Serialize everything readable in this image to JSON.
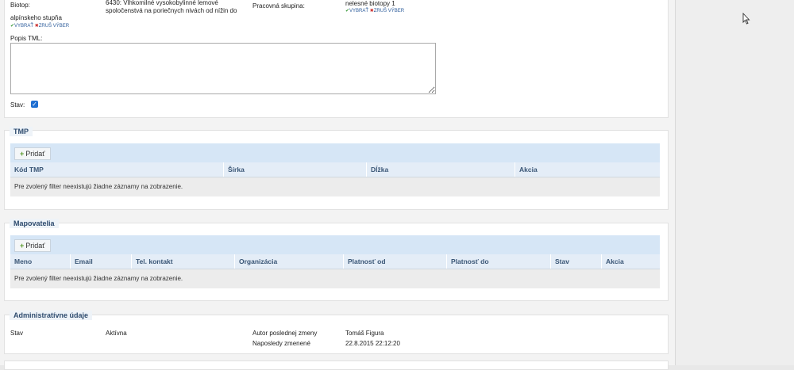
{
  "form": {
    "biotop_label": "Biotop:",
    "biotop_extra": "alpínskeho stupňa",
    "biotop_value_line1": "6430: Vlhkomilné vysokobylinné lemové",
    "biotop_value_line2": "spoločenstvá na poriečnych nivách od nížin do",
    "pracovna_label": "Pracovná skupina:",
    "pracovna_value": "nelesné biotopy 1",
    "vybrat": "VYBRAŤ",
    "zrus": "ZRUŠ VÝBER",
    "popis_label": "Popis TML:",
    "popis_value": "",
    "stav_label": "Stav:"
  },
  "tmp": {
    "title": "TMP",
    "add_label": "Pridať",
    "columns": [
      "Kód TMP",
      "Šírka",
      "Dĺžka",
      "Akcia"
    ],
    "empty_text": "Pre zvolený filter neexistujú žiadne záznamy na zobrazenie."
  },
  "mapovatelia": {
    "title": "Mapovatelia",
    "add_label": "Pridať",
    "columns": [
      "Meno",
      "Email",
      "Tel. kontakt",
      "Organizácia",
      "Platnosť od",
      "Platnosť do",
      "Stav",
      "Akcia"
    ],
    "empty_text": "Pre zvolený filter neexistujú žiadne záznamy na zobrazenie."
  },
  "admin": {
    "title": "Administratívne údaje",
    "stav_label": "Stav",
    "stav_value": "Aktívna",
    "autor_label": "Autor poslednej zmeny",
    "autor_value": "Tomáš Figura",
    "zmenene_label": "Naposledy zmenené",
    "zmenene_value": "22.8.2015 22:12:20"
  },
  "colors": {
    "toolbar": "#d6e6f6",
    "header": "#e4edf7",
    "legend_text": "#2e4b6e",
    "checkbox": "#1f6fd1"
  }
}
